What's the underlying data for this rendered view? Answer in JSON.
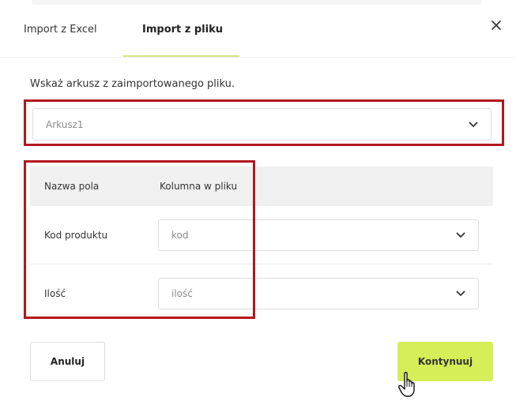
{
  "tabs": [
    {
      "label": "Import z Excel"
    },
    {
      "label": "Import z pliku"
    }
  ],
  "close_icon": "close-icon",
  "instruction": "Wskaż arkusz z zaimportowanego pliku.",
  "sheet_select": {
    "value": "Arkusz1",
    "icon": "chevron-down-icon"
  },
  "table": {
    "headers": [
      "Nazwa pola",
      "Kolumna w pliku"
    ],
    "rows": [
      {
        "field": "Kod produktu",
        "column": "kod"
      },
      {
        "field": "Ilość",
        "column": "ilość"
      }
    ]
  },
  "buttons": {
    "cancel": "Anuluj",
    "continue": "Kontynuuj"
  },
  "colors": {
    "accent": "#d6ee57",
    "highlight": "#b3161d"
  }
}
